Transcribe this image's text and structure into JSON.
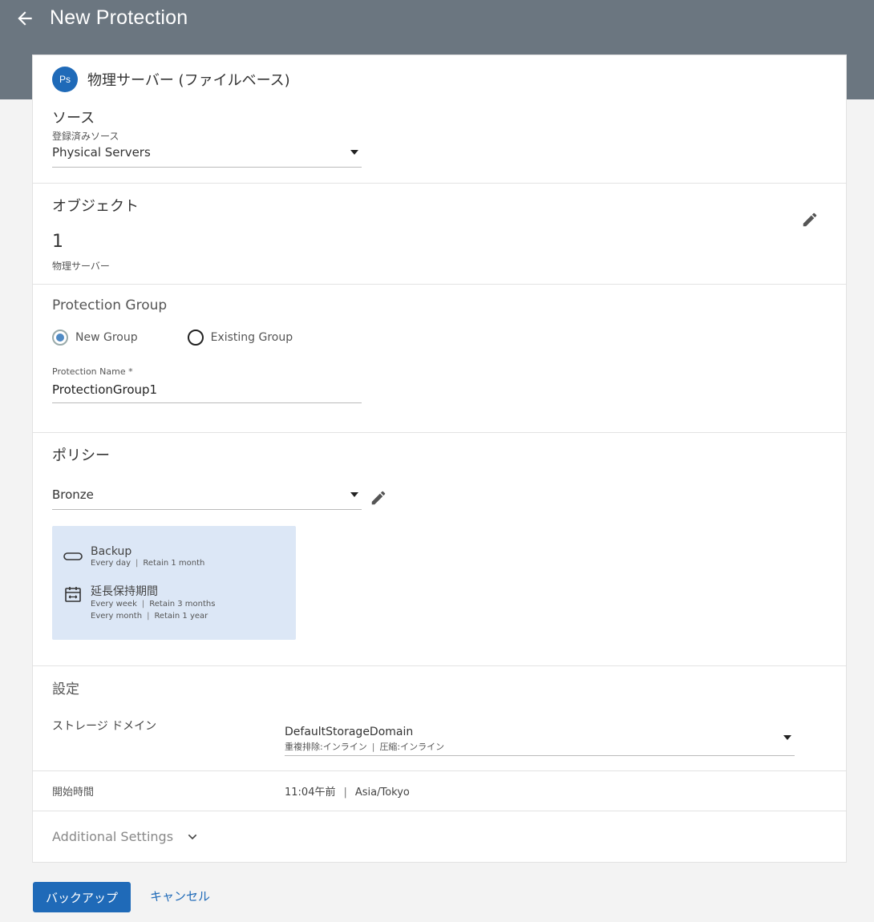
{
  "header": {
    "title": "New Protection"
  },
  "environment": {
    "badge": "Ps",
    "title": "物理サーバー (ファイルベース)"
  },
  "source": {
    "title": "ソース",
    "field_label": "登録済みソース",
    "selected": "Physical Servers"
  },
  "objects": {
    "title": "オブジェクト",
    "count": "1",
    "count_label": "物理サーバー"
  },
  "protection_group": {
    "title": "Protection Group",
    "options": [
      {
        "label": "New Group",
        "selected": true
      },
      {
        "label": "Existing Group",
        "selected": false
      }
    ],
    "name_label": "Protection Name *",
    "name_value": "ProtectionGroup1"
  },
  "policy": {
    "title": "ポリシー",
    "selected": "Bronze",
    "backup": {
      "title": "Backup",
      "frequency": "Every day",
      "retention": "Retain 1 month"
    },
    "extended": {
      "title": "延長保持期間",
      "rows": [
        {
          "frequency": "Every week",
          "retention": "Retain 3 months"
        },
        {
          "frequency": "Every month",
          "retention": "Retain 1 year"
        }
      ]
    }
  },
  "settings": {
    "title": "設定",
    "storage_label": "ストレージ ドメイン",
    "storage_value": "DefaultStorageDomain",
    "storage_dedup": "重複排除:インライン",
    "storage_compress": "圧縮:インライン",
    "start_label": "開始時間",
    "start_time": "11:04午前",
    "timezone": "Asia/Tokyo"
  },
  "additional": {
    "label": "Additional Settings"
  },
  "actions": {
    "primary": "バックアップ",
    "cancel": "キャンセル"
  },
  "colors": {
    "header_bg": "#6b7680",
    "accent": "#1f6ab8",
    "policy_card_bg": "#dce7f6"
  }
}
